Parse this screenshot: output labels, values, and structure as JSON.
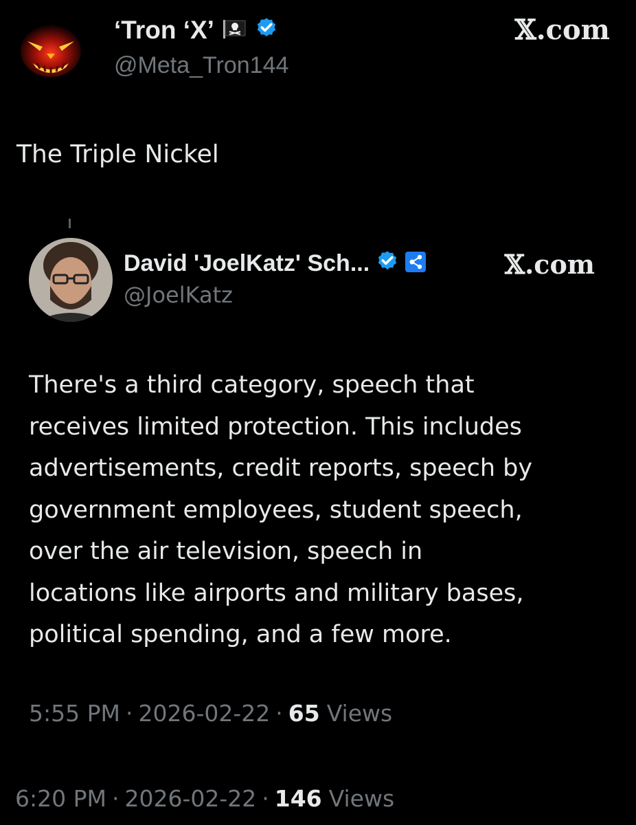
{
  "outer_post": {
    "display_name": "‘Tron ‘X’",
    "handle": "@Meta_Tron144",
    "site": "𝕏.com",
    "text": "The Triple Nickel",
    "time": "6:20 PM",
    "date": "2026-02-22",
    "views_count": "146",
    "views_label": "Views",
    "separator": "·"
  },
  "quoted_post": {
    "display_name": "David 'JoelKatz' Sch...",
    "handle": "@JoelKatz",
    "site": "𝕏.com",
    "text_lines": [
      "There's a third category, speech that",
      "receives limited protection. This includes",
      "advertisements, credit reports, speech by",
      "government employees, student speech,",
      "over the air television, speech in",
      "locations like airports and military bases,",
      "political spending, and a few more."
    ],
    "time": "5:55 PM",
    "date": "2026-02-22",
    "views_count": "65",
    "views_label": "Views",
    "separator": "·"
  },
  "icons": {
    "verified_badge": "verified-badge-icon",
    "pirate_flag": "pirate-flag-icon",
    "affiliate_badge": "xrp-affiliate-icon"
  },
  "colors": {
    "background": "#000000",
    "text_primary": "#e7e9ea",
    "text_secondary": "#71767b",
    "verified_blue": "#1d9bf0"
  }
}
